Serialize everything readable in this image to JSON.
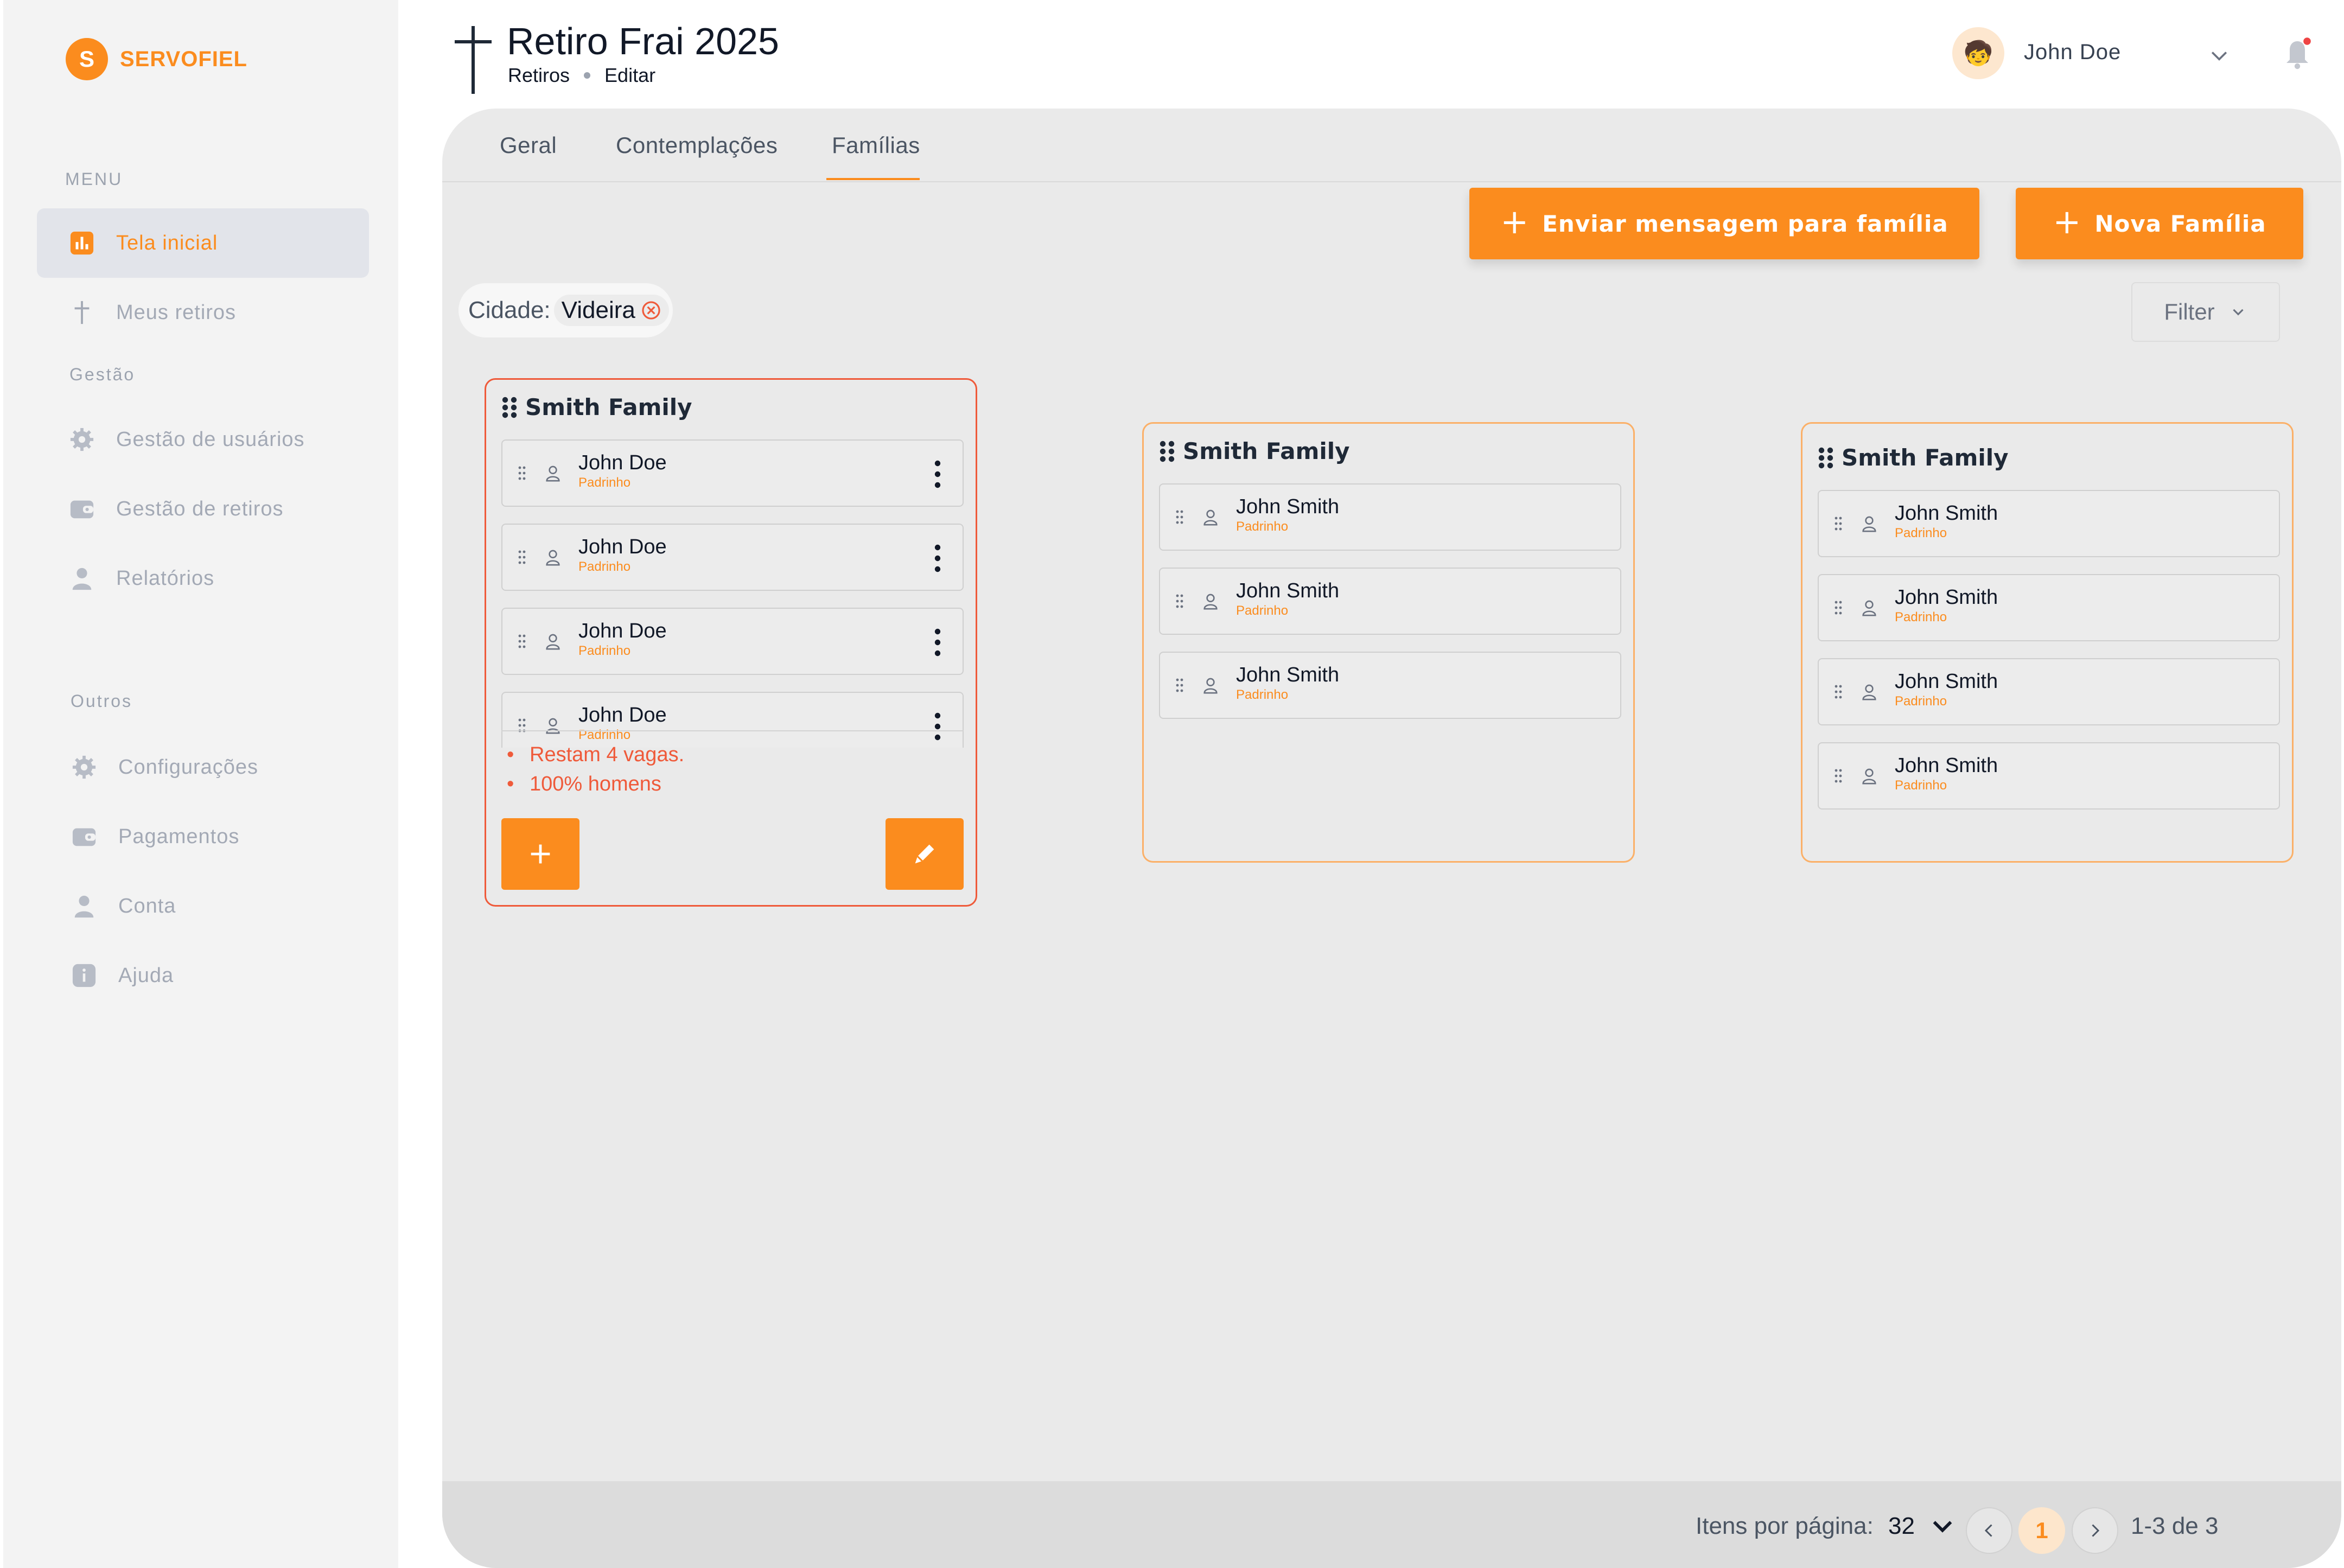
{
  "app": {
    "logo_letter": "S",
    "logo_text": "SERVOFIEL"
  },
  "sidebar": {
    "menu_label": "MENU",
    "gestao_label": "Gestão",
    "outros_label": "Outros",
    "items": [
      {
        "label": "Tela inicial",
        "icon": "chart-icon",
        "active": true
      },
      {
        "label": "Meus retiros",
        "icon": "cross-icon"
      },
      {
        "label": "Gestão de usuários",
        "icon": "gear-icon"
      },
      {
        "label": "Gestão de retiros",
        "icon": "wallet-icon"
      },
      {
        "label": "Relatórios",
        "icon": "user-icon"
      },
      {
        "label": "Configurações",
        "icon": "gear-icon"
      },
      {
        "label": "Pagamentos",
        "icon": "wallet-icon"
      },
      {
        "label": "Conta",
        "icon": "user-icon"
      },
      {
        "label": "Ajuda",
        "icon": "info-icon"
      }
    ]
  },
  "header": {
    "title": "Retiro Frai 2025",
    "breadcrumb": [
      "Retiros",
      "Editar"
    ],
    "user_name": "John Doe",
    "avatar_emoji": "🧒"
  },
  "tabs": [
    {
      "label": "Geral"
    },
    {
      "label": "Contemplações"
    },
    {
      "label": "Famílias",
      "active": true
    }
  ],
  "actions": {
    "send_message": "Enviar mensagem para família",
    "new_family": "Nova Família",
    "filter": "Filter"
  },
  "active_filter": {
    "label": "Cidade:",
    "value": "Videira"
  },
  "families": [
    {
      "name": "Smith Family",
      "members": [
        {
          "name": "John Doe",
          "role": "Padrinho"
        },
        {
          "name": "John Doe",
          "role": "Padrinho"
        },
        {
          "name": "John Doe",
          "role": "Padrinho"
        },
        {
          "name": "John Doe",
          "role": "Padrinho"
        }
      ],
      "notes": [
        "Restam 4 vagas.",
        "100% homens"
      ]
    },
    {
      "name": "Smith Family",
      "members": [
        {
          "name": "John Smith",
          "role": "Padrinho"
        },
        {
          "name": "John Smith",
          "role": "Padrinho"
        },
        {
          "name": "John Smith",
          "role": "Padrinho"
        }
      ]
    },
    {
      "name": "Smith Family",
      "members": [
        {
          "name": "John Smith",
          "role": "Padrinho"
        },
        {
          "name": "John Smith",
          "role": "Padrinho"
        },
        {
          "name": "John Smith",
          "role": "Padrinho"
        },
        {
          "name": "John Smith",
          "role": "Padrinho"
        }
      ]
    }
  ],
  "pagination": {
    "per_page_label": "Itens por página:",
    "per_page": "32",
    "current_page": "1",
    "range": "1-3 de 3"
  },
  "colors": {
    "accent": "#fb8c1e",
    "alert": "#ef5a3a",
    "card_border": "#fbb068"
  }
}
